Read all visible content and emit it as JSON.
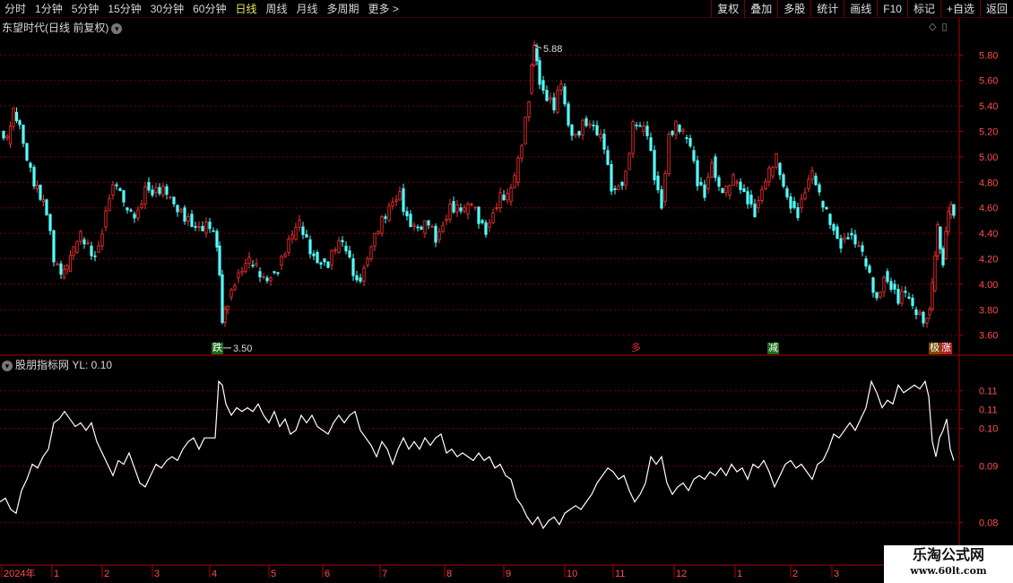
{
  "toolbar": {
    "periods": [
      "分时",
      "1分钟",
      "5分钟",
      "15分钟",
      "30分钟",
      "60分钟",
      "日线",
      "周线",
      "月线",
      "多周期",
      "更多 >"
    ],
    "active_period": "日线",
    "tools": [
      "复权",
      "叠加",
      "多股",
      "统计",
      "画线",
      "F10",
      "标记",
      "+自选",
      "返回"
    ]
  },
  "main_panel": {
    "title": "东望时代(日线 前复权)",
    "dropdown_icon": "chevron-down-icon",
    "panel_icons": [
      "◇",
      "▯"
    ],
    "y_axis_labels": [
      "5.80",
      "5.60",
      "5.40",
      "5.20",
      "5.00",
      "4.80",
      "4.60",
      "4.40",
      "4.20",
      "4.00",
      "3.80",
      "3.60"
    ],
    "high_label": "5.88",
    "low_label": "3.50",
    "tags": {
      "die": "跌",
      "red_mark": "多",
      "jian": "减",
      "zhang1": "极",
      "zhang2": "涨"
    }
  },
  "indicator_panel": {
    "title": "股朋指标网  YL: 0.10",
    "y_axis_labels": [
      "0.11",
      "0.11",
      "0.10",
      "0.09",
      "0.08"
    ]
  },
  "time_axis": {
    "labels": [
      "2024年",
      "1",
      "2",
      "3",
      "4",
      "5",
      "6",
      "7",
      "8",
      "9",
      "10",
      "11",
      "12",
      "1",
      "2",
      "3"
    ]
  },
  "watermark": {
    "line1": "乐淘公式网",
    "line2": "www.60lt.com"
  },
  "colors": {
    "up": "#ff3232",
    "down": "#54ffff",
    "indicator": "#ffffff",
    "grid": "#7a0000",
    "axis_text": "#ff4d4d"
  },
  "chart_data": {
    "type": "candlestick",
    "title": "东望时代(日线 前复权)",
    "ylim": [
      3.45,
      5.95
    ],
    "notable": {
      "high": 5.88,
      "low": 3.5
    },
    "close_path": [
      [
        0,
        5.2
      ],
      [
        8,
        5.1
      ],
      [
        15,
        5.35
      ],
      [
        22,
        5.25
      ],
      [
        30,
        4.95
      ],
      [
        38,
        4.75
      ],
      [
        45,
        4.65
      ],
      [
        52,
        4.55
      ],
      [
        60,
        4.15
      ],
      [
        68,
        4.05
      ],
      [
        75,
        4.1
      ],
      [
        82,
        4.25
      ],
      [
        90,
        4.35
      ],
      [
        98,
        4.3
      ],
      [
        106,
        4.25
      ],
      [
        114,
        4.45
      ],
      [
        122,
        4.7
      ],
      [
        130,
        4.75
      ],
      [
        138,
        4.6
      ],
      [
        146,
        4.55
      ],
      [
        154,
        4.6
      ],
      [
        162,
        4.8
      ],
      [
        170,
        4.72
      ],
      [
        178,
        4.7
      ],
      [
        186,
        4.68
      ],
      [
        194,
        4.62
      ],
      [
        202,
        4.6
      ],
      [
        210,
        4.55
      ],
      [
        218,
        4.45
      ],
      [
        226,
        4.4
      ],
      [
        234,
        4.42
      ],
      [
        242,
        4.3
      ],
      [
        248,
        3.7
      ],
      [
        254,
        3.9
      ],
      [
        262,
        4.05
      ],
      [
        270,
        4.1
      ],
      [
        278,
        4.15
      ],
      [
        286,
        4.1
      ],
      [
        294,
        4.05
      ],
      [
        302,
        4.1
      ],
      [
        310,
        4.15
      ],
      [
        318,
        4.25
      ],
      [
        326,
        4.35
      ],
      [
        334,
        4.45
      ],
      [
        342,
        4.35
      ],
      [
        350,
        4.25
      ],
      [
        358,
        4.2
      ],
      [
        366,
        4.15
      ],
      [
        374,
        4.25
      ],
      [
        382,
        4.3
      ],
      [
        390,
        4.2
      ],
      [
        398,
        4.05
      ],
      [
        406,
        4.15
      ],
      [
        414,
        4.3
      ],
      [
        422,
        4.4
      ],
      [
        430,
        4.5
      ],
      [
        438,
        4.65
      ],
      [
        446,
        4.75
      ],
      [
        454,
        4.55
      ],
      [
        462,
        4.45
      ],
      [
        470,
        4.4
      ],
      [
        478,
        4.45
      ],
      [
        486,
        4.35
      ],
      [
        494,
        4.5
      ],
      [
        502,
        4.65
      ],
      [
        510,
        4.6
      ],
      [
        518,
        4.55
      ],
      [
        526,
        4.6
      ],
      [
        534,
        4.5
      ],
      [
        542,
        4.45
      ],
      [
        550,
        4.6
      ],
      [
        558,
        4.7
      ],
      [
        566,
        4.65
      ],
      [
        574,
        4.8
      ],
      [
        582,
        5.1
      ],
      [
        590,
        5.5
      ],
      [
        596,
        5.85
      ],
      [
        602,
        5.6
      ],
      [
        610,
        5.45
      ],
      [
        618,
        5.35
      ],
      [
        626,
        5.55
      ],
      [
        634,
        5.25
      ],
      [
        642,
        5.2
      ],
      [
        650,
        5.3
      ],
      [
        658,
        5.25
      ],
      [
        666,
        5.15
      ],
      [
        674,
        5.05
      ],
      [
        682,
        4.75
      ],
      [
        690,
        4.8
      ],
      [
        698,
        4.9
      ],
      [
        706,
        5.25
      ],
      [
        714,
        5.2
      ],
      [
        722,
        5.15
      ],
      [
        730,
        4.85
      ],
      [
        738,
        4.65
      ],
      [
        746,
        5.2
      ],
      [
        754,
        5.25
      ],
      [
        762,
        5.15
      ],
      [
        770,
        5.05
      ],
      [
        778,
        4.8
      ],
      [
        786,
        4.75
      ],
      [
        794,
        5.0
      ],
      [
        802,
        4.75
      ],
      [
        810,
        4.7
      ],
      [
        818,
        4.8
      ],
      [
        826,
        4.75
      ],
      [
        834,
        4.7
      ],
      [
        842,
        4.6
      ],
      [
        850,
        4.75
      ],
      [
        858,
        4.85
      ],
      [
        866,
        4.95
      ],
      [
        874,
        4.75
      ],
      [
        882,
        4.65
      ],
      [
        890,
        4.6
      ],
      [
        898,
        4.75
      ],
      [
        906,
        4.85
      ],
      [
        914,
        4.65
      ],
      [
        922,
        4.55
      ],
      [
        930,
        4.45
      ],
      [
        938,
        4.35
      ],
      [
        946,
        4.4
      ],
      [
        954,
        4.3
      ],
      [
        962,
        4.2
      ],
      [
        970,
        4.05
      ],
      [
        978,
        3.9
      ],
      [
        986,
        4.1
      ],
      [
        994,
        4.0
      ],
      [
        1002,
        3.85
      ],
      [
        1010,
        3.9
      ],
      [
        1018,
        3.8
      ],
      [
        1026,
        3.78
      ],
      [
        1034,
        3.76
      ],
      [
        1040,
        3.95
      ],
      [
        1046,
        4.45
      ],
      [
        1052,
        4.2
      ],
      [
        1058,
        4.55
      ],
      [
        1064,
        4.6
      ]
    ],
    "indicator_ylim": [
      0.075,
      0.125
    ],
    "indicator_path": [
      [
        0,
        0.087
      ],
      [
        6,
        0.088
      ],
      [
        12,
        0.085
      ],
      [
        18,
        0.084
      ],
      [
        24,
        0.09
      ],
      [
        30,
        0.093
      ],
      [
        36,
        0.097
      ],
      [
        42,
        0.096
      ],
      [
        48,
        0.099
      ],
      [
        54,
        0.101
      ],
      [
        60,
        0.108
      ],
      [
        66,
        0.109
      ],
      [
        72,
        0.111
      ],
      [
        78,
        0.109
      ],
      [
        84,
        0.107
      ],
      [
        90,
        0.108
      ],
      [
        96,
        0.106
      ],
      [
        102,
        0.108
      ],
      [
        108,
        0.103
      ],
      [
        114,
        0.1
      ],
      [
        120,
        0.097
      ],
      [
        126,
        0.094
      ],
      [
        132,
        0.098
      ],
      [
        138,
        0.097
      ],
      [
        144,
        0.1
      ],
      [
        150,
        0.096
      ],
      [
        156,
        0.092
      ],
      [
        162,
        0.091
      ],
      [
        168,
        0.094
      ],
      [
        174,
        0.097
      ],
      [
        180,
        0.096
      ],
      [
        186,
        0.098
      ],
      [
        192,
        0.099
      ],
      [
        198,
        0.098
      ],
      [
        204,
        0.101
      ],
      [
        210,
        0.103
      ],
      [
        216,
        0.104
      ],
      [
        222,
        0.101
      ],
      [
        228,
        0.104
      ],
      [
        234,
        0.104
      ],
      [
        240,
        0.104
      ],
      [
        244,
        0.119
      ],
      [
        248,
        0.118
      ],
      [
        252,
        0.113
      ],
      [
        258,
        0.11
      ],
      [
        264,
        0.112
      ],
      [
        270,
        0.111
      ],
      [
        276,
        0.112
      ],
      [
        282,
        0.111
      ],
      [
        288,
        0.113
      ],
      [
        294,
        0.11
      ],
      [
        300,
        0.108
      ],
      [
        306,
        0.111
      ],
      [
        312,
        0.107
      ],
      [
        318,
        0.109
      ],
      [
        324,
        0.105
      ],
      [
        330,
        0.106
      ],
      [
        336,
        0.11
      ],
      [
        342,
        0.108
      ],
      [
        348,
        0.11
      ],
      [
        354,
        0.107
      ],
      [
        360,
        0.106
      ],
      [
        366,
        0.105
      ],
      [
        372,
        0.108
      ],
      [
        378,
        0.11
      ],
      [
        384,
        0.108
      ],
      [
        390,
        0.11
      ],
      [
        396,
        0.111
      ],
      [
        402,
        0.106
      ],
      [
        408,
        0.104
      ],
      [
        414,
        0.102
      ],
      [
        420,
        0.099
      ],
      [
        426,
        0.103
      ],
      [
        432,
        0.101
      ],
      [
        438,
        0.097
      ],
      [
        444,
        0.101
      ],
      [
        450,
        0.104
      ],
      [
        456,
        0.101
      ],
      [
        462,
        0.103
      ],
      [
        468,
        0.101
      ],
      [
        474,
        0.104
      ],
      [
        480,
        0.102
      ],
      [
        486,
        0.104
      ],
      [
        492,
        0.105
      ],
      [
        498,
        0.1
      ],
      [
        504,
        0.101
      ],
      [
        510,
        0.099
      ],
      [
        516,
        0.1
      ],
      [
        522,
        0.099
      ],
      [
        528,
        0.098
      ],
      [
        534,
        0.1
      ],
      [
        540,
        0.098
      ],
      [
        546,
        0.099
      ],
      [
        552,
        0.096
      ],
      [
        558,
        0.097
      ],
      [
        564,
        0.094
      ],
      [
        570,
        0.093
      ],
      [
        576,
        0.088
      ],
      [
        582,
        0.086
      ],
      [
        588,
        0.083
      ],
      [
        594,
        0.081
      ],
      [
        600,
        0.083
      ],
      [
        606,
        0.08
      ],
      [
        612,
        0.082
      ],
      [
        618,
        0.083
      ],
      [
        624,
        0.081
      ],
      [
        630,
        0.084
      ],
      [
        636,
        0.085
      ],
      [
        642,
        0.086
      ],
      [
        648,
        0.085
      ],
      [
        654,
        0.087
      ],
      [
        660,
        0.089
      ],
      [
        666,
        0.092
      ],
      [
        672,
        0.094
      ],
      [
        678,
        0.096
      ],
      [
        684,
        0.095
      ],
      [
        690,
        0.093
      ],
      [
        696,
        0.094
      ],
      [
        702,
        0.09
      ],
      [
        708,
        0.087
      ],
      [
        714,
        0.089
      ],
      [
        720,
        0.092
      ],
      [
        726,
        0.099
      ],
      [
        732,
        0.097
      ],
      [
        738,
        0.099
      ],
      [
        744,
        0.092
      ],
      [
        750,
        0.089
      ],
      [
        756,
        0.091
      ],
      [
        762,
        0.092
      ],
      [
        768,
        0.09
      ],
      [
        774,
        0.093
      ],
      [
        780,
        0.094
      ],
      [
        786,
        0.093
      ],
      [
        792,
        0.095
      ],
      [
        798,
        0.094
      ],
      [
        804,
        0.096
      ],
      [
        810,
        0.094
      ],
      [
        816,
        0.097
      ],
      [
        822,
        0.095
      ],
      [
        828,
        0.096
      ],
      [
        834,
        0.093
      ],
      [
        840,
        0.097
      ],
      [
        846,
        0.096
      ],
      [
        852,
        0.098
      ],
      [
        858,
        0.095
      ],
      [
        864,
        0.091
      ],
      [
        870,
        0.094
      ],
      [
        876,
        0.097
      ],
      [
        882,
        0.098
      ],
      [
        888,
        0.096
      ],
      [
        894,
        0.097
      ],
      [
        900,
        0.095
      ],
      [
        906,
        0.093
      ],
      [
        912,
        0.097
      ],
      [
        918,
        0.098
      ],
      [
        924,
        0.101
      ],
      [
        930,
        0.105
      ],
      [
        936,
        0.104
      ],
      [
        942,
        0.106
      ],
      [
        948,
        0.108
      ],
      [
        954,
        0.106
      ],
      [
        960,
        0.109
      ],
      [
        966,
        0.112
      ],
      [
        972,
        0.119
      ],
      [
        978,
        0.116
      ],
      [
        984,
        0.112
      ],
      [
        990,
        0.114
      ],
      [
        996,
        0.113
      ],
      [
        1002,
        0.118
      ],
      [
        1008,
        0.116
      ],
      [
        1014,
        0.117
      ],
      [
        1020,
        0.118
      ],
      [
        1026,
        0.117
      ],
      [
        1032,
        0.119
      ],
      [
        1036,
        0.115
      ],
      [
        1040,
        0.103
      ],
      [
        1044,
        0.099
      ],
      [
        1048,
        0.104
      ],
      [
        1052,
        0.106
      ],
      [
        1056,
        0.109
      ],
      [
        1060,
        0.101
      ],
      [
        1064,
        0.098
      ]
    ]
  }
}
